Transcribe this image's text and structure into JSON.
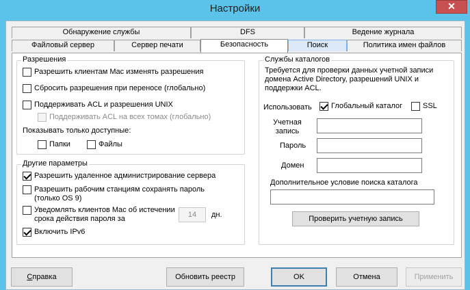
{
  "window": {
    "title": "Настройки",
    "close_glyph": "✕"
  },
  "tabs": {
    "row1": [
      "Обнаружение службы",
      "DFS",
      "Ведение журнала"
    ],
    "row2": [
      "Файловый сервер",
      "Сервер печати",
      "Безопасность",
      "Поиск",
      "Политика имен файлов"
    ],
    "selected": "Безопасность"
  },
  "permissions": {
    "title": "Разрешения",
    "allow_mac_change": {
      "label": "Разрешить клиентам Mac изменять разрешения",
      "checked": false
    },
    "reset_on_move": {
      "label": "Сбросить разрешения при переносе (глобально)",
      "checked": false
    },
    "support_acl": {
      "label": "Поддерживать ACL и разрешения UNIX",
      "checked": false
    },
    "acl_all_volumes": {
      "label": "Поддерживать ACL на всех томах (глобально)",
      "checked": false,
      "disabled": true
    },
    "show_only_label": "Показывать только доступные:",
    "folders": {
      "label": "Папки",
      "checked": false
    },
    "files": {
      "label": "Файлы",
      "checked": false
    }
  },
  "other": {
    "title": "Другие параметры",
    "remote_admin": {
      "label": "Разрешить удаленное администрирование сервера",
      "checked": true
    },
    "save_password": {
      "label": "Разрешить рабочим станциям сохранять пароль (только OS 9)",
      "checked": false
    },
    "notify_expiry": {
      "label": "Уведомлять клиентов Mac об истечении срока действия пароля за",
      "checked": false
    },
    "expiry_days": "14",
    "days_unit": "дн.",
    "ipv6": {
      "label": "Включить IPv6",
      "checked": true
    }
  },
  "directory": {
    "title": "Службы каталогов",
    "description": "Требуется для проверки данных учетной записи домена Active Directory, разрешений UNIX и поддержки ACL.",
    "use_label": "Использовать",
    "global_catalog": {
      "label": "Глобальный каталог",
      "checked": true
    },
    "ssl": {
      "label": "SSL",
      "checked": false
    },
    "account_label": "Учетная запись",
    "account_value": "",
    "password_label": "Пароль",
    "password_value": "",
    "domain_label": "Домен",
    "domain_value": "",
    "extra_condition_label": "Дополнительное условие поиска каталога",
    "extra_condition_value": "",
    "verify_button": "Проверить учетную запись"
  },
  "buttons": {
    "help": "Справка",
    "refresh_registry": "Обновить реестр",
    "ok": "OK",
    "cancel": "Отмена",
    "apply": "Применить"
  }
}
